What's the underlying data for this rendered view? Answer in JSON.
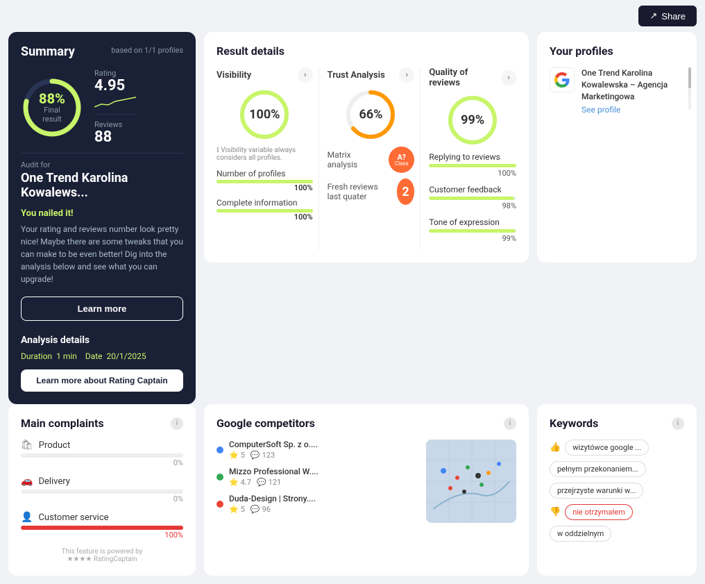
{
  "topbar": {
    "share_label": "Share"
  },
  "summary": {
    "title": "Summary",
    "based_on": "based on 1/1 profiles",
    "final_percent": "88%",
    "final_label": "Final result",
    "rating_label": "Rating",
    "rating_value": "4.95",
    "reviews_label": "Reviews",
    "reviews_value": "88",
    "audit_for": "Audit for",
    "audit_name": "One Trend Karolina Kowalews...",
    "nailed_title": "You nailed it!",
    "nailed_desc": "Your rating and reviews number look pretty nice! Maybe there are some tweaks that you can make to be even better! Dig into the analysis below and see what you can upgrade!",
    "learn_more_label": "Learn more",
    "analysis_title": "Analysis details",
    "duration_label": "Duration",
    "duration_value": "1 min",
    "date_label": "Date",
    "date_value": "20/1/2025",
    "learn_captain_label": "Learn more about Rating Captain"
  },
  "result_details": {
    "title": "Result details",
    "visibility": {
      "label": "Visibility",
      "value": "100%",
      "note": "Visibility variable always considers all profiles."
    },
    "trust": {
      "label": "Trust Analysis",
      "value": "66%"
    },
    "quality": {
      "label": "Quality of reviews",
      "value": "99%"
    },
    "number_of_profiles": {
      "label": "Number of profiles",
      "value": "100%"
    },
    "complete_information": {
      "label": "Complete information",
      "value": "100%"
    },
    "matrix": {
      "label": "Matrix analysis",
      "class": "A?",
      "class_sub": "Class"
    },
    "fresh_reviews": {
      "label": "Fresh reviews last quater",
      "value": "2"
    },
    "replying_to_reviews": {
      "label": "Replying to reviews",
      "value": "100%"
    },
    "customer_feedback": {
      "label": "Customer feedback",
      "value": "98%"
    },
    "tone_of_expression": {
      "label": "Tone of expression",
      "value": "99%"
    }
  },
  "profiles": {
    "title": "Your profiles",
    "items": [
      {
        "name": "One Trend Karolina Kowalewska – Agencja Marketingowa",
        "see_profile": "See profile"
      }
    ]
  },
  "complaints": {
    "title": "Main complaints",
    "items": [
      {
        "label": "Product",
        "value": 0,
        "display": "0%",
        "icon": "🛍"
      },
      {
        "label": "Delivery",
        "value": 0,
        "display": "0%",
        "icon": "🚗"
      },
      {
        "label": "Customer service",
        "value": 100,
        "display": "100%",
        "icon": "👤"
      }
    ],
    "powered_by": "This feature is powered by",
    "powered_brand": "★★★★ RatingCaptain"
  },
  "competitors": {
    "title": "Google competitors",
    "items": [
      {
        "name": "ComputerSoft Sp. z o....",
        "rating": "5",
        "reviews": "123"
      },
      {
        "name": "Mizzo Professional W....",
        "rating": "4.7",
        "reviews": "121"
      },
      {
        "name": "Duda-Design | Strony....",
        "rating": "5",
        "reviews": "96"
      }
    ]
  },
  "keywords": {
    "title": "Keywords",
    "items": [
      {
        "label": "wizytówce google ...",
        "highlighted": false,
        "icon": "👍"
      },
      {
        "label": "pełnym przekonaniem...",
        "highlighted": false,
        "icon": null
      },
      {
        "label": "przejrzyste warunki w...",
        "highlighted": false,
        "icon": null
      },
      {
        "label": "nie otrzymałem",
        "highlighted": true,
        "icon": "👎"
      },
      {
        "label": "w oddzielnym",
        "highlighted": false,
        "icon": null
      }
    ]
  }
}
